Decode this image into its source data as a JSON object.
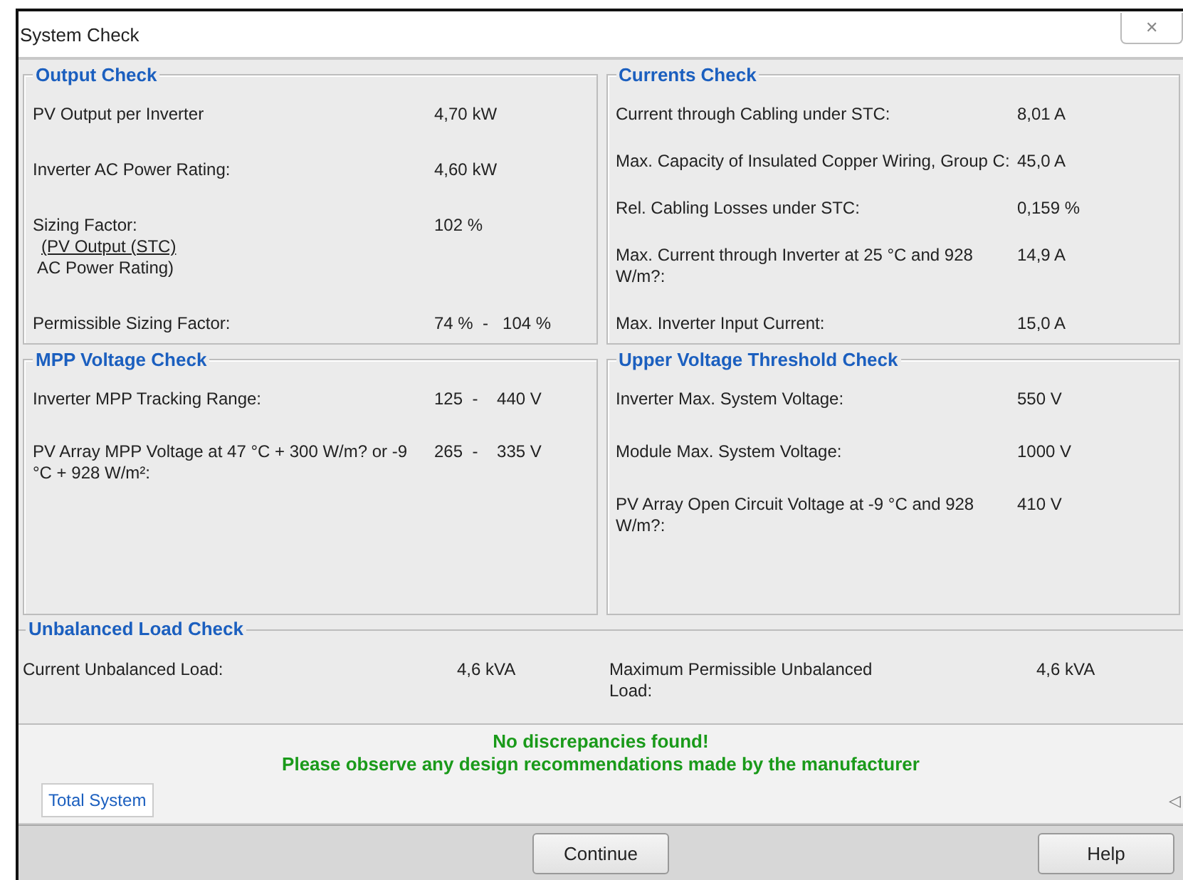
{
  "window": {
    "title": "System Check",
    "close": "✕"
  },
  "groups": [
    {
      "title": "Output Check",
      "rows": [
        {
          "label": "PV Output per Inverter",
          "value": "4,70 kW"
        },
        {
          "label": "Inverter AC Power Rating:",
          "value": "4,60 kW"
        },
        {
          "label": "Sizing Factor:",
          "value": "102 %",
          "formula": {
            "numerator": "(PV Output (STC)",
            "denominator": "AC Power Rating)"
          }
        },
        {
          "label": "Permissible Sizing Factor:",
          "value": "74 %  -   104 %"
        }
      ]
    },
    {
      "title": "Currents Check",
      "rows": [
        {
          "label": "Current through Cabling under STC:",
          "value": "8,01 A"
        },
        {
          "label": "Max. Capacity of Insulated Copper Wiring, Group C:",
          "value": "45,0 A"
        },
        {
          "label": "Rel. Cabling Losses under STC:",
          "value": "0,159 %"
        },
        {
          "label": "Max. Current through Inverter at 25 °C and 928 W/m?:",
          "value": "14,9 A"
        },
        {
          "label": "Max. Inverter Input Current:",
          "value": "15,0 A"
        }
      ]
    },
    {
      "title": "MPP Voltage Check",
      "rows": [
        {
          "label": "Inverter MPP Tracking Range:",
          "value": "125  -    440 V"
        },
        {
          "label": "PV Array MPP Voltage at 47 °C + 300  W/m? or -9 °C + 928 W/m²:",
          "value": "265  -    335 V"
        }
      ]
    },
    {
      "title": "Upper Voltage Threshold Check",
      "rows": [
        {
          "label": "Inverter Max. System Voltage:",
          "value": "550 V"
        },
        {
          "label": "Module Max. System Voltage:",
          "value": "1000 V"
        },
        {
          "label": "PV Array Open Circuit Voltage at -9 °C and 928 W/m?:",
          "value": "410 V"
        }
      ]
    }
  ],
  "unbalanced": {
    "title": "Unbalanced Load Check",
    "items": [
      {
        "label": "Current Unbalanced Load:",
        "value": "4,6 kVA"
      },
      {
        "label": "Maximum Permissible Unbalanced Load:",
        "value": "4,6 kVA"
      }
    ]
  },
  "messages": [
    "No discrepancies found!",
    "Please observe any design recommendations made by the manufacturer"
  ],
  "tabs": [
    {
      "label": "Total System",
      "selected": true
    }
  ],
  "tab_scroll": "◁",
  "buttons": [
    {
      "label": "Continue"
    },
    {
      "label": "Help"
    }
  ]
}
